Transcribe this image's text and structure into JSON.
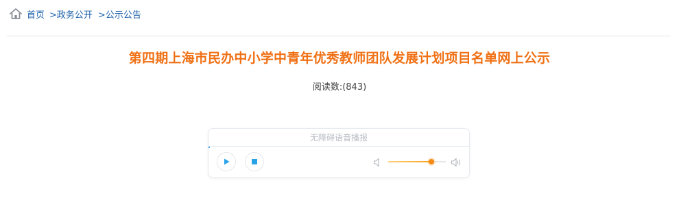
{
  "breadcrumb": {
    "home": "首页",
    "items": [
      ">政务公开",
      ">公示公告"
    ]
  },
  "article": {
    "title": "第四期上海市民办中小学中青年优秀教师团队发展计划项目名单网上公示",
    "read_count": "阅读数:(843)"
  },
  "player": {
    "header": "无障碍语音播报",
    "volume_level": 0.75
  },
  "colors": {
    "title": "#f07014",
    "link": "#1a5ea8",
    "play_icon": "#29a3e8",
    "volume_accent": "#f48a14"
  },
  "icons": [
    "home-icon",
    "play-icon",
    "stop-icon",
    "volume-low-icon",
    "volume-high-icon"
  ]
}
